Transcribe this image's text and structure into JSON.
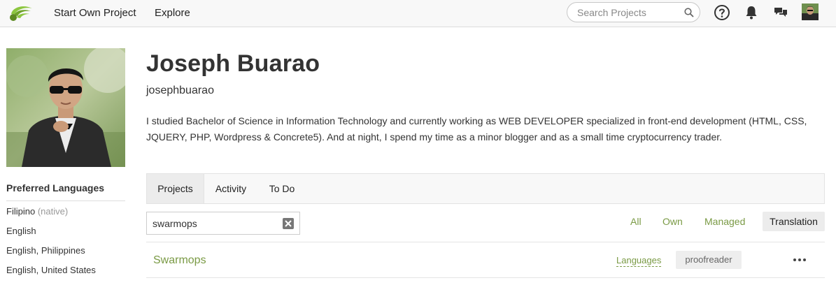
{
  "nav": {
    "start_project": "Start Own Project",
    "explore": "Explore",
    "search_placeholder": "Search Projects",
    "icons": [
      "logo-icon",
      "search-icon",
      "help-icon",
      "bell-icon",
      "chat-icon"
    ]
  },
  "profile": {
    "name": "Joseph Buarao",
    "username": "josephbuarao",
    "bio": "I studied Bachelor of Science in Information Technology and currently working as WEB DEVELOPER specialized in front-end development (HTML, CSS, JQUERY, PHP, Wordpress & Concrete5). And at night, I spend my time as a minor blogger and as a small time cryptocurrency trader."
  },
  "preferred_languages": {
    "title": "Preferred Languages",
    "items": [
      {
        "label": "Filipino",
        "note": "(native)"
      },
      {
        "label": "English",
        "note": ""
      },
      {
        "label": "English, Philippines",
        "note": ""
      },
      {
        "label": "English, United States",
        "note": ""
      }
    ]
  },
  "tabs": [
    {
      "label": "Projects",
      "active": true
    },
    {
      "label": "Activity",
      "active": false
    },
    {
      "label": "To Do",
      "active": false
    }
  ],
  "project_filter": {
    "value": "swarmops",
    "filters": [
      {
        "label": "All",
        "active": false
      },
      {
        "label": "Own",
        "active": false
      },
      {
        "label": "Managed",
        "active": false
      },
      {
        "label": "Translation",
        "active": true
      }
    ]
  },
  "projects": [
    {
      "name": "Swarmops",
      "languages_link": "Languages",
      "role": "proofreader",
      "more": "•••"
    }
  ],
  "colors": {
    "accent_green": "#7a9a45",
    "logo_green": "#8cc63f",
    "topbar_bg": "#f8f8f8"
  }
}
